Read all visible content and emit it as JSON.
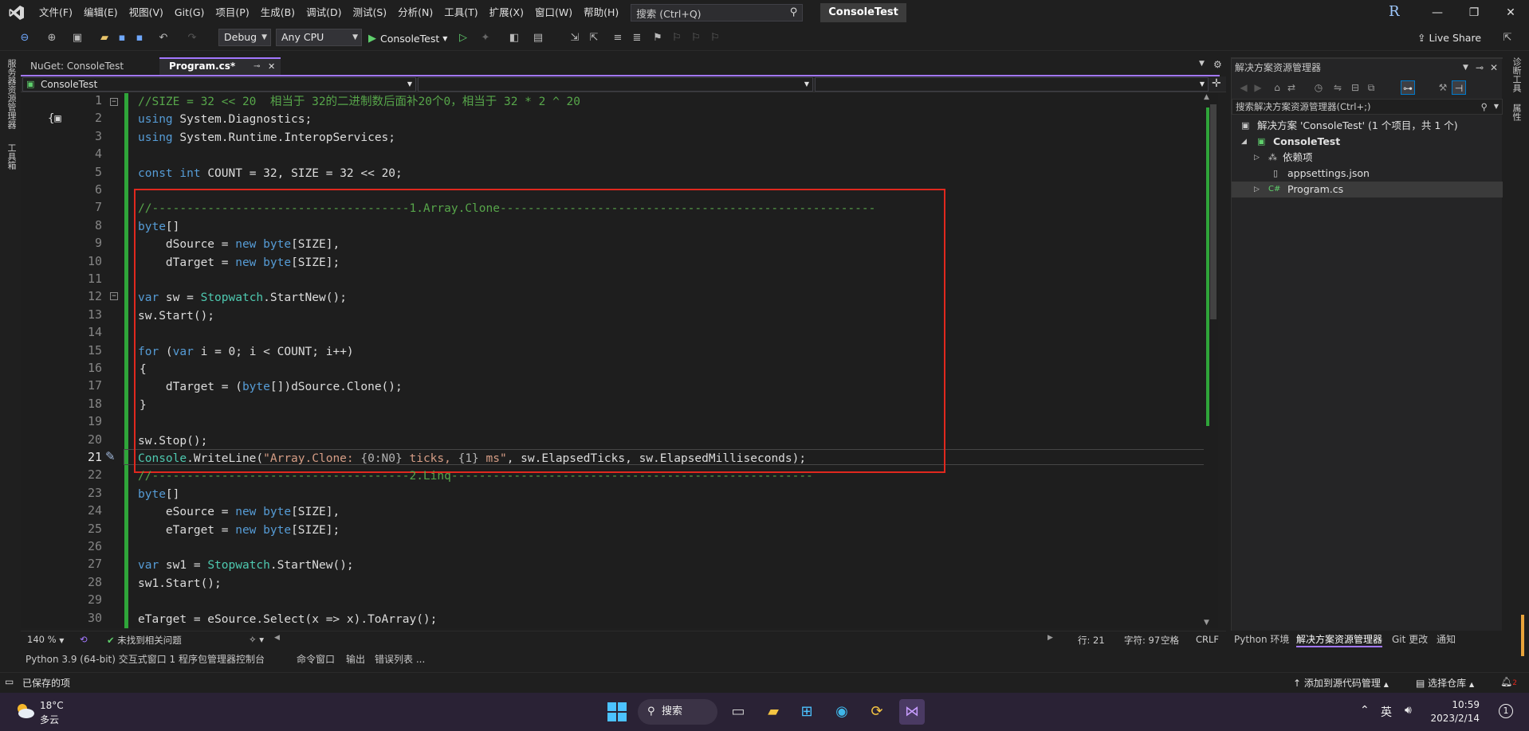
{
  "titlebar": {
    "menus": [
      "文件(F)",
      "编辑(E)",
      "视图(V)",
      "Git(G)",
      "项目(P)",
      "生成(B)",
      "调试(D)",
      "测试(S)",
      "分析(N)",
      "工具(T)",
      "扩展(X)",
      "窗口(W)",
      "帮助(H)"
    ],
    "search_placeholder": "搜索 (Ctrl+Q)",
    "solution_name": "ConsoleTest",
    "account_initial": "R"
  },
  "toolbar": {
    "config": "Debug",
    "platform": "Any CPU",
    "run_target": "ConsoleTest",
    "live_share": "Live Share"
  },
  "left_strip": {
    "tabs": [
      "服务器资源管理器",
      "工具箱"
    ]
  },
  "doc_tabs": [
    {
      "label": "NuGet: ConsoleTest",
      "active": false
    },
    {
      "label": "Program.cs*",
      "active": true
    }
  ],
  "navbar": {
    "project": "ConsoleTest"
  },
  "editor": {
    "line_numbers": [
      "1",
      "2",
      "3",
      "4",
      "5",
      "6",
      "7",
      "8",
      "9",
      "10",
      "11",
      "12",
      "13",
      "14",
      "15",
      "16",
      "17",
      "18",
      "19",
      "20",
      "21",
      "22",
      "23",
      "24",
      "25",
      "26",
      "27",
      "28",
      "29",
      "30"
    ],
    "current_line": 21
  },
  "code": {
    "l1": "//SIZE = 32 << 20  相当于 32的二进制数后面补20个0，相当于 32 * 2 ^ 20",
    "l2_kw": "using",
    "l2_rest": " System.Diagnostics;",
    "l3_kw": "using",
    "l3_rest": " System.Runtime.InteropServices;",
    "l5_kw": "const",
    "l5_kw2": "int",
    "l5_rest": " COUNT = 32, SIZE = 32 << 20;",
    "l7": "//-------------------------------------1.Array.Clone------------------------------------------------------",
    "l8_kw": "byte",
    "l8_rest": "[]",
    "l9_a": "    dSource = ",
    "l9_kw": "new",
    "l9_kw2": "byte",
    "l9_rest": "[SIZE],",
    "l10_a": "    dTarget = ",
    "l10_kw": "new",
    "l10_kw2": "byte",
    "l10_rest": "[SIZE];",
    "l12_kw": "var",
    "l12_a": " sw = ",
    "l12_ty": "Stopwatch",
    "l12_rest": ".StartNew();",
    "l13": "sw.Start();",
    "l15_kw": "for",
    "l15_a": " (",
    "l15_kw2": "var",
    "l15_rest": " i = 0; i < COUNT; i++)",
    "l16": "{",
    "l17_a": "    dTarget = (",
    "l17_kw": "byte",
    "l17_rest": "[])dSource.Clone();",
    "l18": "}",
    "l20": "sw.Stop();",
    "l21_ty": "Console",
    "l21_a": ".WriteLine(",
    "l21_s1": "\"Array.Clone: ",
    "l21_f1": "{0:N0}",
    "l21_s2": " ticks, ",
    "l21_f2": "{1}",
    "l21_s3": " ms\"",
    "l21_rest": ", sw.ElapsedTicks, sw.ElapsedMilliseconds);",
    "l22": "//-------------------------------------2.Linq----------------------------------------------------",
    "l23_kw": "byte",
    "l23_rest": "[]",
    "l24_a": "    eSource = ",
    "l24_kw": "new",
    "l24_kw2": "byte",
    "l24_rest": "[SIZE],",
    "l25_a": "    eTarget = ",
    "l25_kw": "new",
    "l25_kw2": "byte",
    "l25_rest": "[SIZE];",
    "l27_kw": "var",
    "l27_a": " sw1 = ",
    "l27_ty": "Stopwatch",
    "l27_rest": ".StartNew();",
    "l28": "sw1.Start();",
    "l30": "eTarget = eSource.Select(x => x).ToArray();"
  },
  "editor_status": {
    "zoom": "140 %",
    "issues": "未找到相关问题",
    "line": "行: 21",
    "col": "字符: 97",
    "spaces": "空格",
    "eol": "CRLF"
  },
  "bottom_tabs": [
    "Python 3.9 (64-bit) 交互式窗口 1",
    "程序包管理器控制台",
    "命令窗口",
    "输出",
    "错误列表 ..."
  ],
  "solution_explorer": {
    "title": "解决方案资源管理器",
    "search_placeholder": "搜索解决方案资源管理器(Ctrl+;)",
    "solution": "解决方案 'ConsoleTest' (1 个项目，共 1 个)",
    "project": "ConsoleTest",
    "deps": "依赖项",
    "appsettings": "appsettings.json",
    "program": "Program.cs"
  },
  "right_tabs": [
    "Python 环境",
    "解决方案资源管理器",
    "Git 更改",
    "通知"
  ],
  "right_strip": {
    "tabs": [
      "诊断工具",
      "属性"
    ]
  },
  "statusbar": {
    "saved": "已保存的项",
    "source_control": "添加到源代码管理",
    "repo": "选择仓库",
    "notif_count": "2"
  },
  "taskbar": {
    "temp": "18°C",
    "weather": "多云",
    "search": "搜索",
    "lang": "英",
    "time": "10:59",
    "date": "2023/2/14",
    "badge": "1"
  },
  "colors": {
    "accent": "#a277ff",
    "highlight_box": "#e0281e",
    "change_bar": "#2fa53a"
  }
}
